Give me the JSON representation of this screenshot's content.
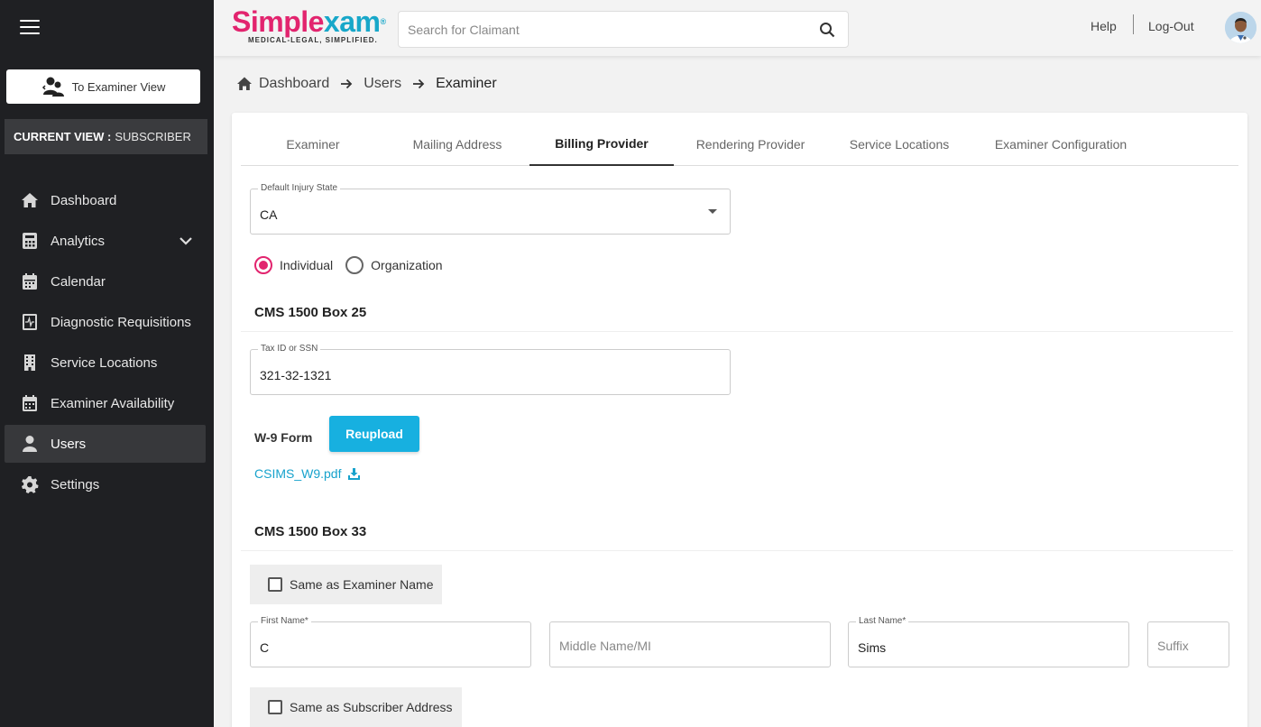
{
  "sidebar": {
    "examiner_view_label": "To Examiner View",
    "current_view_label": "CURRENT VIEW :",
    "current_view_value": "SUBSCRIBER",
    "items": [
      {
        "label": "Dashboard",
        "icon": "home-icon"
      },
      {
        "label": "Analytics",
        "icon": "calculator-icon"
      },
      {
        "label": "Calendar",
        "icon": "calendar-icon"
      },
      {
        "label": "Diagnostic Requisitions",
        "icon": "clipboard-icon"
      },
      {
        "label": "Service Locations",
        "icon": "building-icon"
      },
      {
        "label": "Examiner Availability",
        "icon": "calendar-check-icon"
      },
      {
        "label": "Users",
        "icon": "user-icon"
      },
      {
        "label": "Settings",
        "icon": "gear-icon"
      }
    ],
    "active_item": "Users"
  },
  "header": {
    "logo_part1": "Simple",
    "logo_part2": "xam",
    "logo_reg": "®",
    "logo_tagline": "MEDICAL-LEGAL, SIMPLIFIED.",
    "search_placeholder": "Search for Claimant",
    "help_label": "Help",
    "logout_label": "Log-Out"
  },
  "breadcrumb": [
    "Dashboard",
    "Users",
    "Examiner"
  ],
  "tabs": [
    "Examiner",
    "Mailing Address",
    "Billing Provider",
    "Rendering Provider",
    "Service Locations",
    "Examiner Configuration"
  ],
  "active_tab": "Billing Provider",
  "form": {
    "injury_state": {
      "label": "Default Injury State",
      "value": "CA"
    },
    "radio": {
      "individual": "Individual",
      "organization": "Organization",
      "selected": "Individual"
    },
    "box25_title": "CMS 1500 Box 25",
    "tax_id": {
      "label": "Tax ID or SSN",
      "value": "321-32-1321"
    },
    "w9_label": "W-9 Form",
    "reupload_label": "Reupload",
    "w9_file": "CSIMS_W9.pdf",
    "box33_title": "CMS 1500 Box 33",
    "same_as_examiner": "Same as Examiner Name",
    "first_name": {
      "label": "First Name*",
      "value": "C"
    },
    "middle_name": {
      "placeholder": "Middle Name/MI"
    },
    "last_name": {
      "label": "Last Name*",
      "value": "Sims"
    },
    "suffix": {
      "placeholder": "Suffix"
    },
    "same_as_subscriber": "Same as Subscriber Address"
  },
  "colors": {
    "accent_pink": "#e2246e",
    "accent_cyan": "#17b0e0",
    "sidebar_bg": "#1f2023"
  }
}
